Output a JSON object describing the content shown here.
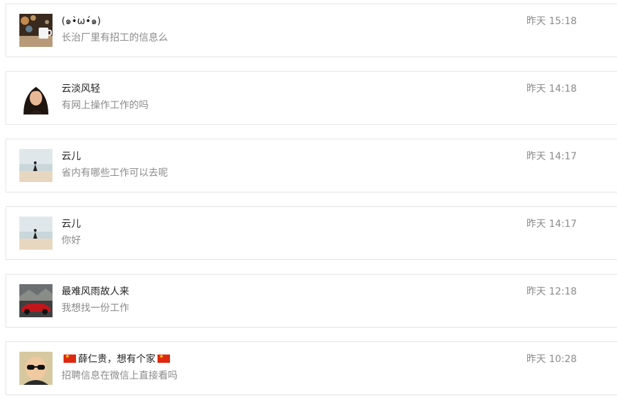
{
  "conversations": [
    {
      "avatar": "avatar-cafe-cup-bokeh",
      "name": "(๑•̀ω•́๑)",
      "message": "长治厂里有招工的信息么",
      "time": "昨天 15:18"
    },
    {
      "avatar": "avatar-woman-portrait",
      "name": "云淡风轻",
      "message": "有网上操作工作的吗",
      "time": "昨天 14:18"
    },
    {
      "avatar": "avatar-girl-on-beach",
      "name": "云儿",
      "message": "省内有哪些工作可以去呢",
      "time": "昨天 14:17"
    },
    {
      "avatar": "avatar-girl-on-beach",
      "name": "云儿",
      "message": "你好",
      "time": "昨天 14:17"
    },
    {
      "avatar": "avatar-red-sports-car",
      "name": "最难风雨故人来",
      "message": "我想找一份工作",
      "time": "昨天 12:18"
    },
    {
      "avatar": "avatar-child-sunglasses",
      "name_flag_icon": "china-flag-icon",
      "name": "薛仁贵，想有个家",
      "message": "招聘信息在微信上直接看吗",
      "time": "昨天 10:28"
    }
  ]
}
